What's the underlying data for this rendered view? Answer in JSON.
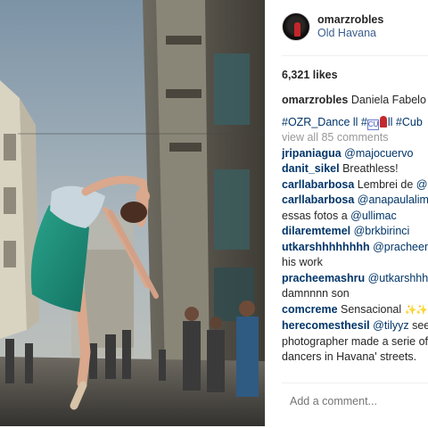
{
  "post": {
    "username": "omarzrobles",
    "location": "Old Havana",
    "likes": "6,321 likes",
    "caption_user": "omarzrobles",
    "caption_text": " Daniela Fabelo",
    "hashtag_1": "#OZR_Dance ll #",
    "hashtag_box": "CU",
    "hashtag_2": "ll #Cub",
    "view_all": "view all 85 comments"
  },
  "comments": [
    {
      "user": "jripaniagua",
      "mention": "@majocuervo",
      "text": ""
    },
    {
      "user": "danit_sikel",
      "text": " Breathless!"
    },
    {
      "user": "carllabarbosa",
      "text": " Lembrei de ",
      "mention": "@ulli"
    },
    {
      "user": "carllabarbosa",
      "mention": "@anapaulalimoe",
      "text": "",
      "text2": "essas fotos a ",
      "mention2": "@ullimac"
    },
    {
      "user": "dilaremtemel",
      "mention": "@brkbirinci",
      "text": ""
    },
    {
      "user": "utkarshhhhhhhh",
      "mention": "@pracheemas",
      "text": "",
      "text2": "his work"
    },
    {
      "user": "pracheemashru",
      "mention": "@utkarshhhhhh",
      "text": "",
      "text2": "damnnnn son"
    },
    {
      "user": "comcreme",
      "text": " Sensacional"
    },
    {
      "user": "herecomesthesil",
      "mention": "@tilyyz",
      "text": " see th",
      "text2": "photographer made a serie of p",
      "text3": "dancers in Havana' streets."
    }
  ],
  "add_comment_placeholder": "Add a comment...",
  "icons": {
    "heart": "heart-outline-icon",
    "avatar": "profile-avatar"
  },
  "colors": {
    "link": "#003569",
    "location": "#3b5f8f",
    "muted": "#999999"
  }
}
